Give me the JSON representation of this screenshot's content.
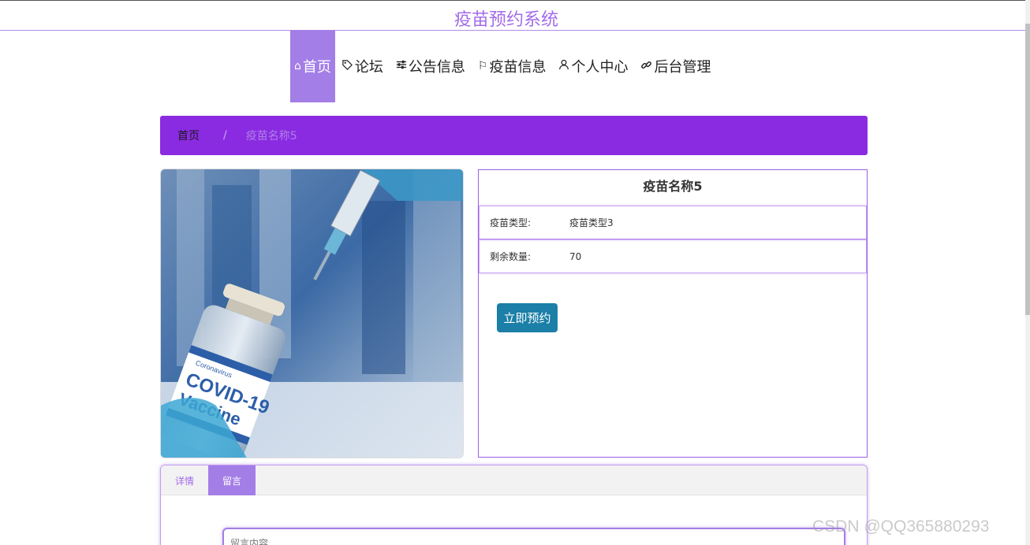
{
  "site": {
    "title": "疫苗预约系统"
  },
  "nav": {
    "items": [
      {
        "label": "首页",
        "icon": "home-icon"
      },
      {
        "label": "论坛",
        "icon": "tag-icon"
      },
      {
        "label": "公告信息",
        "icon": "sliders-icon"
      },
      {
        "label": "疫苗信息",
        "icon": "flag-icon"
      },
      {
        "label": "个人中心",
        "icon": "user-icon"
      },
      {
        "label": "后台管理",
        "icon": "link-icon"
      }
    ],
    "active": "首页"
  },
  "breadcrumb": {
    "home": "首页",
    "separator": "/",
    "current": "疫苗名称5"
  },
  "vaccine": {
    "name": "疫苗名称5",
    "fields": [
      {
        "label": "疫苗类型:",
        "value": "疫苗类型3"
      },
      {
        "label": "剩余数量:",
        "value": "70"
      }
    ],
    "book_button": "立即预约",
    "image_text": {
      "small": "Coronavirus",
      "line1": "COVID-19",
      "line2": "Vaccine"
    }
  },
  "tabs": {
    "items": [
      "详情",
      "留言"
    ],
    "active": "留言"
  },
  "comment": {
    "placeholder": "留言内容"
  },
  "watermark": "CSDN @QQ365880293",
  "colors": {
    "accent": "#a37ee6",
    "breadcrumb_bg": "#8a2be2",
    "button": "#1b7fa8"
  }
}
